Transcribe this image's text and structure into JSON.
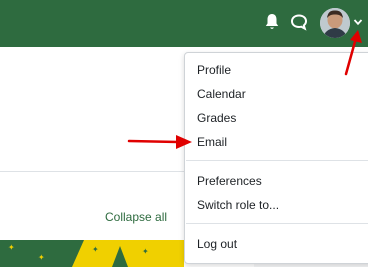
{
  "navbar": {
    "icons": [
      "bell-icon",
      "chat-icon",
      "avatar",
      "chevron-down-icon"
    ],
    "bg_color": "#2e6b3f"
  },
  "course": {
    "collapse_all": "Collapse all",
    "banner_colors": [
      "#f0d000",
      "#2e6b3f"
    ]
  },
  "user_menu": {
    "items": [
      {
        "label": "Profile"
      },
      {
        "label": "Calendar"
      },
      {
        "label": "Grades"
      },
      {
        "label": "Email"
      },
      {
        "label": "Preferences"
      },
      {
        "label": "Switch role to..."
      },
      {
        "label": "Log out"
      }
    ]
  },
  "annotations": {
    "arrow_color": "#e00000"
  }
}
